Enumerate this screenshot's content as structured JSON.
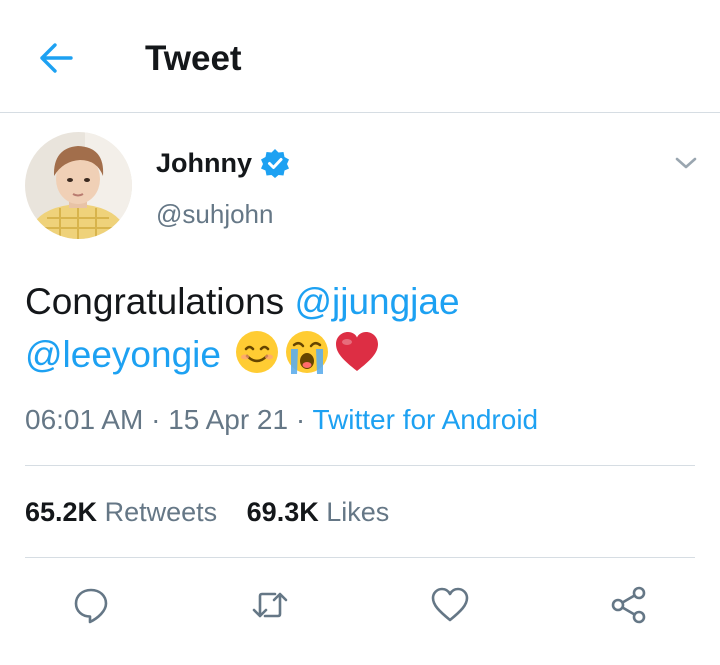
{
  "header": {
    "title": "Tweet",
    "back_icon": "arrow-left-icon"
  },
  "tweet": {
    "author_name": "Johnny",
    "verified": true,
    "handle": "@suhjohn",
    "text_prefix": "Congratulations ",
    "mention_1": "@jjungjae",
    "mention_2": "@leeyongie",
    "emojis": [
      "smiling-face-icon",
      "crying-face-icon",
      "red-heart-icon"
    ],
    "time": "06:01 AM",
    "date": "15 Apr 21",
    "source": "Twitter for Android",
    "separator": "·"
  },
  "stats": {
    "retweets_count": "65.2K",
    "retweets_label": "Retweets",
    "likes_count": "69.3K",
    "likes_label": "Likes"
  },
  "actions": [
    "reply-icon",
    "retweet-icon",
    "like-icon",
    "share-icon"
  ],
  "colors": {
    "accent": "#1da1f2",
    "text": "#14171a",
    "secondary": "#657786",
    "divider": "#d6dde3"
  }
}
